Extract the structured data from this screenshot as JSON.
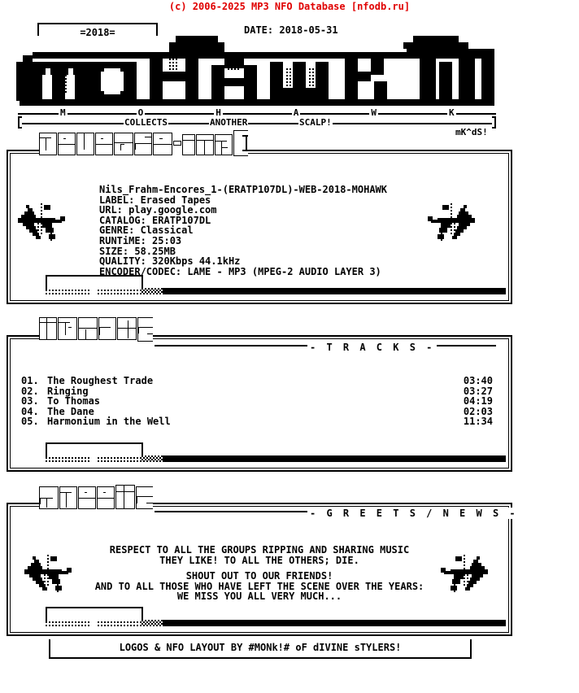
{
  "banner": {
    "text": "(c) 2006-2025 MP3 NFO Database [nfodb.ru]",
    "color": "#e00000"
  },
  "header": {
    "year_tab": "=2018=",
    "date": "DATE: 2018-05-31",
    "group_logo": "MOHAWK",
    "letters": [
      "M",
      "O",
      "H",
      "A",
      "W",
      "K"
    ],
    "tagline_1": "COLLECTS",
    "tagline_2": "ANOTHER",
    "tagline_3": "SCALP!",
    "signature": "mK^dS!"
  },
  "release": {
    "ascii_title": "release-info",
    "dirname": "Nils_Frahm-Encores_1-(ERATP107DL)-WEB-2018-MOHAWK",
    "fields": [
      "LABEL: Erased Tapes",
      "URL: play.google.com",
      "CATALOG: ERATP107DL",
      "GENRE: Classical",
      "RUNTiME: 25:03",
      "SIZE: 58.25MB",
      "QUALITY: 320Kbps 44.1kHz",
      "ENCODER/CODEC: LAME - MP3 (MPEG-2 AUDIO LAYER 3)"
    ]
  },
  "tracks": {
    "ascii_title": "tracks",
    "label": "- T R A C K S -",
    "items": [
      {
        "no": "01.",
        "title": "The Roughest Trade",
        "time": "03:40"
      },
      {
        "no": "02.",
        "title": "Ringing",
        "time": "03:27"
      },
      {
        "no": "03.",
        "title": "To Thomas",
        "time": "04:19"
      },
      {
        "no": "04.",
        "title": "The Dane",
        "time": "02:03"
      },
      {
        "no": "05.",
        "title": "Harmonium in the Well",
        "time": "11:34"
      }
    ]
  },
  "greets": {
    "ascii_title": "greets",
    "label": "- G R E E T S / N E W S -",
    "lines": [
      "RESPECT TO ALL THE GROUPS RIPPING AND SHARING MUSIC",
      "THEY LIKE! TO ALL THE OTHERS; DIE.",
      "",
      "SHOUT OUT TO OUR FRIENDS!",
      "AND TO ALL THOSE WHO HAVE LEFT THE SCENE OVER THE YEARS:",
      "WE MISS YOU ALL VERY MUCH..."
    ]
  },
  "footer": {
    "text": "LOGOS & NFO LAYOUT BY #MONk!# oF dIVINE sTYLERS!"
  }
}
